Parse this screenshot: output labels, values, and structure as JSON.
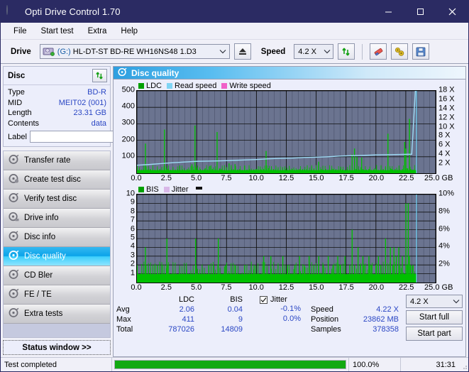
{
  "window": {
    "title": "Opti Drive Control 1.70",
    "icon": "disc-icon",
    "minimize": "–",
    "maximize": "□",
    "close": "✕"
  },
  "menubar": {
    "items": [
      {
        "label": "File",
        "accel": "F"
      },
      {
        "label": "Start test",
        "accel": "S"
      },
      {
        "label": "Extra",
        "accel": "x"
      },
      {
        "label": "Help",
        "accel": "H"
      }
    ]
  },
  "toolbar": {
    "drive_label": "Drive",
    "drive_value_prefix": "(G:)",
    "drive_value": "HL-DT-ST BD-RE  WH16NS48 1.D3",
    "drive_icon": "drive-icon",
    "eject_icon": "eject-icon",
    "speed_label": "Speed",
    "speed_value": "4.2 X",
    "refresh_icon": "refresh-icon",
    "erase_icon": "eraser-icon",
    "bookmark_icon": "tools-icon",
    "save_icon": "floppy-save-icon"
  },
  "disc_panel": {
    "title": "Disc",
    "refresh_icon": "refresh-icon",
    "rows": [
      {
        "key": "Type",
        "value": "BD-R"
      },
      {
        "key": "MID",
        "value": "MEIT02 (001)"
      },
      {
        "key": "Length",
        "value": "23.31 GB"
      },
      {
        "key": "Contents",
        "value": "data"
      }
    ],
    "label_key": "Label",
    "label_value": "",
    "label_placeholder": "",
    "label_button_icon": "disc-icon"
  },
  "sidebar": {
    "items": [
      {
        "label": "Transfer rate",
        "icon": "disc-rate-icon",
        "active": false
      },
      {
        "label": "Create test disc",
        "icon": "disc-create-icon",
        "active": false
      },
      {
        "label": "Verify test disc",
        "icon": "disc-verify-icon",
        "active": false
      },
      {
        "label": "Drive info",
        "icon": "disc-drive-icon",
        "active": false
      },
      {
        "label": "Disc info",
        "icon": "disc-info-icon",
        "active": false
      },
      {
        "label": "Disc quality",
        "icon": "disc-quality-icon",
        "active": true
      },
      {
        "label": "CD Bler",
        "icon": "disc-bler-icon",
        "active": false
      },
      {
        "label": "FE / TE",
        "icon": "disc-fete-icon",
        "active": false
      },
      {
        "label": "Extra tests",
        "icon": "disc-extra-icon",
        "active": false
      }
    ],
    "status_window_button": "Status window >>"
  },
  "main": {
    "panel_title": "Disc quality",
    "panel_icon": "disc-quality-icon"
  },
  "chart_data": [
    {
      "type": "line",
      "name": "top-chart",
      "title": "LDC / speed",
      "xlabel": "GB",
      "ylabel": "",
      "xlim": [
        0,
        25
      ],
      "ylim": [
        0,
        500
      ],
      "y2lim": [
        0,
        18
      ],
      "grid": true,
      "legend_position": "top-left",
      "legend": [
        {
          "label": "LDC",
          "color": "#00a000"
        },
        {
          "label": "Read speed",
          "color": "#7fd4f4"
        },
        {
          "label": "Write speed",
          "color": "#f060c8"
        }
      ],
      "xticks": [
        "0.0",
        "2.5",
        "5.0",
        "7.5",
        "10.0",
        "12.5",
        "15.0",
        "17.5",
        "20.0",
        "22.5",
        "25.0 GB"
      ],
      "yticks": [
        "100",
        "200",
        "300",
        "400",
        "500"
      ],
      "y2ticks": [
        "2 X",
        "4 X",
        "6 X",
        "8 X",
        "10 X",
        "12 X",
        "14 X",
        "16 X",
        "18 X"
      ],
      "series": [
        {
          "name": "LDC",
          "color": "#00c000",
          "type": "bar",
          "x": [
            0.05,
            0.2,
            0.4,
            0.55,
            0.7,
            0.75,
            0.8,
            0.9,
            1.1,
            1.3,
            1.5,
            1.7,
            1.9,
            2.1,
            2.3,
            2.45,
            2.5,
            2.6,
            2.8,
            3.0,
            3.2,
            3.4,
            3.6,
            3.8,
            4.0,
            4.2,
            4.4,
            4.6,
            4.75,
            4.85,
            4.95,
            5.0,
            5.1,
            5.3,
            5.5,
            5.7,
            5.9,
            6.1,
            6.3,
            6.5,
            6.7,
            6.9,
            7.0,
            7.1,
            7.3,
            7.5,
            7.7,
            7.9,
            8.1,
            8.2,
            8.4,
            8.6,
            8.8,
            9.0,
            9.2,
            9.4,
            9.6,
            9.8,
            10.0,
            10.2,
            10.4,
            10.6,
            10.8,
            11.0,
            11.2,
            11.4,
            11.5,
            11.6,
            11.8,
            12.0,
            12.2,
            12.4,
            12.6,
            12.8,
            13.0,
            13.2,
            13.4,
            13.6,
            13.8,
            14.0,
            14.2,
            14.4,
            14.6,
            14.8,
            15.0,
            15.2,
            15.4,
            15.5,
            15.6,
            15.8,
            16.0,
            16.2,
            16.4,
            16.6,
            16.8,
            17.0,
            17.2,
            17.4,
            17.6,
            17.8,
            18.0,
            18.2,
            18.3,
            18.4,
            18.6,
            18.8,
            18.9,
            19.0,
            19.2,
            19.4,
            19.6,
            19.8,
            20.0,
            20.2,
            20.4,
            20.6,
            20.8,
            21.0,
            21.2,
            21.3,
            21.4,
            21.6,
            21.8,
            22.0,
            22.2,
            22.4,
            22.5,
            22.6,
            22.8,
            22.9,
            23.0,
            23.1,
            23.2,
            23.3
          ],
          "values": [
            20,
            25,
            18,
            22,
            180,
            30,
            20,
            22,
            25,
            18,
            20,
            22,
            25,
            20,
            265,
            30,
            22,
            25,
            20,
            18,
            22,
            25,
            20,
            22,
            18,
            25,
            20,
            55,
            22,
            290,
            35,
            20,
            22,
            25,
            20,
            30,
            22,
            45,
            25,
            20,
            250,
            28,
            22,
            25,
            20,
            22,
            60,
            25,
            20,
            55,
            22,
            25,
            20,
            45,
            22,
            25,
            20,
            22,
            25,
            20,
            22,
            25,
            135,
            30,
            22,
            25,
            20,
            22,
            25,
            20,
            22,
            25,
            20,
            22,
            25,
            20,
            22,
            25,
            20,
            22,
            25,
            20,
            22,
            25,
            20,
            70,
            25,
            22,
            20,
            25,
            22,
            20,
            25,
            22,
            20,
            25,
            22,
            20,
            25,
            22,
            115,
            150,
            25,
            100,
            22,
            95,
            25,
            20,
            22,
            25,
            20,
            22,
            25,
            20,
            22,
            25,
            20,
            240,
            30,
            25,
            22,
            25,
            20,
            22,
            25,
            190,
            150,
            30,
            330,
            25,
            20,
            22
          ]
        },
        {
          "name": "Read speed",
          "color": "#9fdcf6",
          "type": "line",
          "x": [
            0.0,
            1.0,
            2.0,
            3.0,
            4.0,
            5.0,
            6.0,
            7.0,
            8.0,
            9.0,
            10.0,
            11.0,
            12.0,
            13.0,
            14.0,
            15.0,
            16.0,
            17.0,
            18.0,
            19.0,
            20.0,
            21.0,
            22.0,
            23.0,
            23.3
          ],
          "values": [
            1.75,
            1.9,
            2.1,
            2.3,
            2.45,
            2.6,
            2.65,
            2.7,
            2.8,
            2.9,
            3.0,
            3.15,
            3.25,
            3.3,
            3.45,
            3.5,
            3.6,
            3.75,
            3.85,
            3.9,
            4.0,
            4.05,
            4.1,
            4.15,
            18.0
          ]
        }
      ]
    },
    {
      "type": "bar",
      "name": "bottom-chart",
      "title": "BIS / jitter",
      "xlabel": "GB",
      "ylabel": "",
      "xlim": [
        0,
        25
      ],
      "ylim": [
        0,
        10
      ],
      "y2lim": [
        0,
        10
      ],
      "grid": true,
      "legend_position": "top-left",
      "legend": [
        {
          "label": "BIS",
          "color": "#00a000"
        },
        {
          "label": "Jitter",
          "color": "#d9b8e8"
        }
      ],
      "xticks": [
        "0.0",
        "2.5",
        "5.0",
        "7.5",
        "10.0",
        "12.5",
        "15.0",
        "17.5",
        "20.0",
        "22.5",
        "25.0 GB"
      ],
      "yticks": [
        "1",
        "2",
        "3",
        "4",
        "5",
        "6",
        "7",
        "8",
        "9",
        "10"
      ],
      "y2ticks": [
        "2%",
        "4%",
        "6%",
        "8%",
        "10%"
      ],
      "series": [
        {
          "name": "BIS",
          "color": "#00c000",
          "type": "bar",
          "x": [
            0.1,
            0.3,
            0.5,
            0.7,
            0.75,
            0.9,
            1.1,
            1.3,
            1.5,
            1.7,
            1.75,
            1.9,
            2.1,
            2.3,
            2.5,
            2.55,
            2.7,
            2.9,
            3.1,
            3.3,
            3.5,
            3.7,
            3.9,
            4.1,
            4.3,
            4.5,
            4.7,
            4.9,
            4.95,
            5.0,
            5.2,
            5.4,
            5.6,
            5.8,
            6.0,
            6.2,
            6.4,
            6.6,
            6.8,
            6.9,
            7.0,
            7.2,
            7.4,
            7.6,
            7.8,
            8.0,
            8.2,
            8.4,
            8.6,
            8.8,
            9.0,
            9.2,
            9.4,
            9.6,
            9.8,
            10.0,
            10.2,
            10.4,
            10.6,
            10.8,
            11.0,
            11.2,
            11.4,
            11.6,
            11.8,
            12.0,
            12.2,
            12.4,
            12.6,
            12.8,
            13.0,
            13.2,
            13.4,
            13.6,
            13.8,
            14.0,
            14.2,
            14.4,
            14.6,
            14.8,
            15.0,
            15.2,
            15.4,
            15.6,
            15.8,
            16.0,
            16.2,
            16.4,
            16.6,
            16.8,
            17.0,
            17.2,
            17.4,
            17.6,
            17.8,
            18.0,
            18.2,
            18.3,
            18.5,
            18.7,
            18.9,
            19.0,
            19.2,
            19.4,
            19.6,
            19.8,
            20.0,
            20.2,
            20.4,
            20.6,
            20.8,
            21.0,
            21.2,
            21.4,
            21.5,
            21.7,
            21.9,
            22.0,
            22.2,
            22.4,
            22.5,
            22.6,
            22.7,
            22.8,
            22.9,
            23.0,
            23.1,
            23.2,
            23.3
          ],
          "values": [
            1,
            1,
            1,
            4,
            2,
            1,
            1,
            1,
            2,
            2,
            1,
            1,
            2,
            1,
            5,
            2,
            1,
            1,
            1,
            1,
            1,
            1,
            1,
            1,
            1,
            1,
            1,
            5,
            2,
            1,
            1,
            1,
            1,
            1,
            2,
            1,
            2,
            1,
            5,
            1,
            1,
            1,
            2,
            1,
            1,
            1,
            2,
            1,
            1,
            1,
            2,
            1,
            1,
            1,
            2,
            1,
            1,
            1,
            3,
            1,
            1,
            3,
            1,
            1,
            2,
            1,
            3,
            1,
            2,
            1,
            1,
            2,
            1,
            3,
            1,
            2,
            1,
            3,
            1,
            2,
            1,
            3,
            1,
            2,
            1,
            3,
            1,
            2,
            1,
            3,
            2,
            1,
            3,
            1,
            2,
            6,
            2,
            1,
            4,
            2,
            3,
            2,
            1,
            3,
            2,
            1,
            2,
            3,
            2,
            1,
            5,
            2,
            4,
            2,
            4,
            3,
            4,
            2,
            3,
            1,
            9,
            2,
            9,
            3,
            2,
            1,
            2,
            1,
            1
          ]
        }
      ]
    }
  ],
  "stats": {
    "columns": [
      "LDC",
      "BIS"
    ],
    "rows": [
      {
        "name": "Avg",
        "ldc": "2.06",
        "bis": "0.04"
      },
      {
        "name": "Max",
        "ldc": "411",
        "bis": "9"
      },
      {
        "name": "Total",
        "ldc": "787026",
        "bis": "14809"
      }
    ],
    "jitter": {
      "checked": true,
      "label": "Jitter",
      "avg": "-0.1%",
      "max": "0.0%"
    },
    "speed_label": "Speed",
    "speed_value": "4.22 X",
    "position_label": "Position",
    "position_value": "23862 MB",
    "samples_label": "Samples",
    "samples_value": "378358",
    "speed_select": "4.2 X",
    "start_full_button": "Start full",
    "start_part_button": "Start part"
  },
  "statusbar": {
    "message": "Test completed",
    "progress_percent": "100.0%",
    "progress_value": 100,
    "elapsed": "31:31"
  },
  "colors": {
    "accent_blue": "#2b47c4",
    "title_bar": "#2b2b63",
    "plot_bg": "#6b7490",
    "ldc_green": "#00c000",
    "read_speed": "#9fdcf6",
    "write_speed": "#f060c8",
    "jitter": "#d9b8e8",
    "progress_green": "#12a912",
    "nav_active": "#0aa3ea"
  }
}
